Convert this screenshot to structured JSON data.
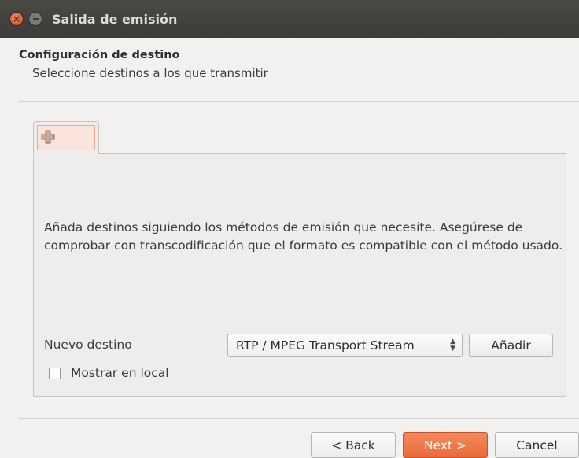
{
  "window": {
    "title": "Salida de emisión"
  },
  "header": {
    "title": "Configuración de destino",
    "subtitle": "Seleccione destinos a los que transmitir"
  },
  "tabs": [
    {
      "icon": "plus-icon"
    }
  ],
  "main": {
    "info_text": "Añada destinos siguiendo los métodos de emisión que necesite. Asegúrese de comprobar con transcodificación que el formato es compatible con el método usado.",
    "new_destination_label": "Nuevo destino",
    "destination_select_value": "RTP / MPEG Transport Stream",
    "add_button_label": "Añadir",
    "show_local_label": "Mostrar en local",
    "show_local_checked": false
  },
  "footer": {
    "back_label": "< Back",
    "next_label": "Next >",
    "cancel_label": "Cancel"
  },
  "colors": {
    "accent": "#e96a3b",
    "titlebar": "#3c3b37",
    "close_button": "#dd4814",
    "tab_highlight": "#fbe4dc"
  }
}
